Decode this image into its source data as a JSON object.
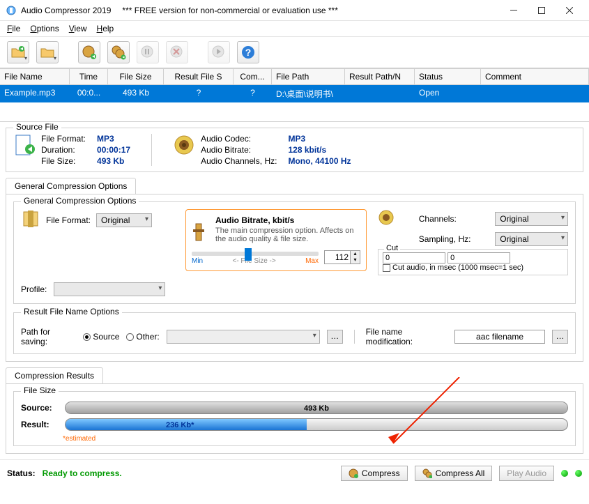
{
  "titlebar": {
    "title": "Audio Compressor 2019",
    "subtitle": "*** FREE version for non-commercial or evaluation use ***"
  },
  "menubar": {
    "file": "File",
    "options": "Options",
    "view": "View",
    "help": "Help"
  },
  "grid": {
    "headers": {
      "name": "File Name",
      "time": "Time",
      "size": "File Size",
      "result": "Result File S",
      "com": "Com...",
      "path": "File Path",
      "rpath": "Result Path/N",
      "status": "Status",
      "comment": "Comment"
    },
    "row": {
      "name": "Example.mp3",
      "time": "00:0...",
      "size": "493 Kb",
      "result": "?",
      "com": "?",
      "path": "D:\\桌面\\说明书\\",
      "rpath": "",
      "status": "Open",
      "comment": ""
    }
  },
  "sourcefile": {
    "legend": "Source File",
    "left": {
      "format_l": "File Format:",
      "format_v": "MP3",
      "dur_l": "Duration:",
      "dur_v": "00:00:17",
      "size_l": "File Size:",
      "size_v": "493 Kb"
    },
    "right": {
      "codec_l": "Audio Codec:",
      "codec_v": "MP3",
      "bitrate_l": "Audio Bitrate:",
      "bitrate_v": "128 kbit/s",
      "chan_l": "Audio Channels, Hz:",
      "chan_v": "Mono, 44100 Hz"
    }
  },
  "tabs": {
    "gco": "General Compression Options",
    "cr": "Compression Results"
  },
  "gco": {
    "legend": "General Compression Options",
    "file_format_l": "File Format:",
    "file_format_v": "Original",
    "bitrate": {
      "title": "Audio Bitrate, kbit/s",
      "sub": "The main compression option. Affects on the audio quality & file size.",
      "min": "Min",
      "max": "Max",
      "filesize": "<- File Size ->",
      "value": "112"
    },
    "channels_l": "Channels:",
    "channels_v": "Original",
    "sampling_l": "Sampling, Hz:",
    "sampling_v": "Original",
    "cut": {
      "legend": "Cut",
      "from": "0",
      "to": "0",
      "label": "Cut audio, in msec (1000 msec=1 sec)"
    },
    "profile_l": "Profile:",
    "result_legend": "Result File Name Options",
    "path_label": "Path for saving:",
    "source": "Source",
    "other": "Other:",
    "fnmod_l": "File name modification:",
    "fnmod_v": "aac filename"
  },
  "cr": {
    "fs_legend": "File Size",
    "source_l": "Source:",
    "source_v": "493 Kb",
    "result_l": "Result:",
    "result_v": "236 Kb*",
    "estimated": "*estimated"
  },
  "footer": {
    "status_l": "Status:",
    "status_v": "Ready to compress.",
    "compress": "Compress",
    "compress_all": "Compress All",
    "play": "Play Audio"
  }
}
